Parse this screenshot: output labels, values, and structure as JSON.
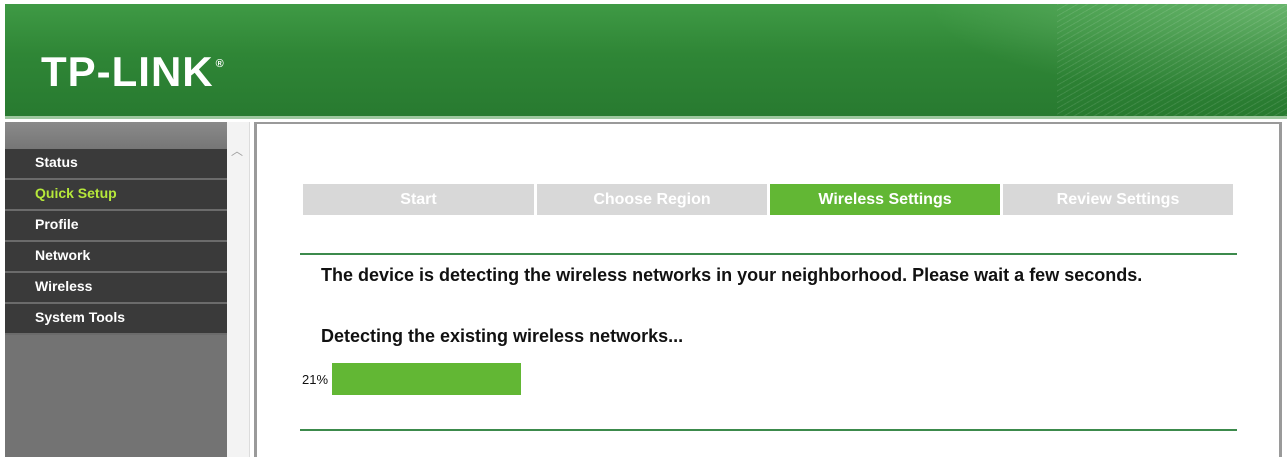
{
  "header": {
    "logo_text": "TP-LINK",
    "logo_mark": "®"
  },
  "sidebar": {
    "items": [
      {
        "label": "Status",
        "active": false
      },
      {
        "label": "Quick Setup",
        "active": true
      },
      {
        "label": "Profile",
        "active": false
      },
      {
        "label": "Network",
        "active": false
      },
      {
        "label": "Wireless",
        "active": false
      },
      {
        "label": "System Tools",
        "active": false
      }
    ]
  },
  "wizard": {
    "steps": [
      {
        "label": "Start",
        "active": false
      },
      {
        "label": "Choose Region",
        "active": false
      },
      {
        "label": "Wireless Settings",
        "active": true
      },
      {
        "label": "Review Settings",
        "active": false
      }
    ]
  },
  "content": {
    "message": "The device is detecting the wireless networks in your neighborhood. Please wait a few seconds.",
    "status": "Detecting the existing wireless networks...",
    "progress_label": "21%",
    "progress": 0.21
  },
  "colors": {
    "accent": "#62b734",
    "header": "#2f8636",
    "active_menu": "#b6e83a"
  }
}
